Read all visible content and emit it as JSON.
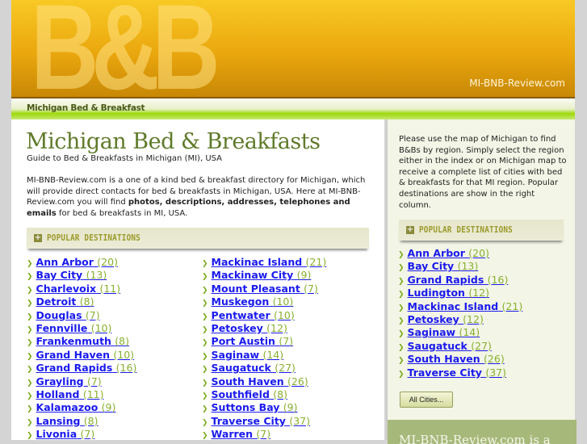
{
  "header": {
    "logo": "B&B",
    "site_name": "MI-BNB-Review.com"
  },
  "nav": {
    "title": "Michigan Bed & Breakfast"
  },
  "main": {
    "title": "Michigan Bed & Breakfasts",
    "subtitle": "Guide to Bed & Breakfasts in Michigan (MI), USA",
    "intro_1": "MI-BNB-Review.com is a one of a kind bed & breakfast directory for Michigan, which will provide direct contacts for bed & breakfasts in Michigan, USA. Here at MI-BNB-Review.com you will find ",
    "intro_bold": "photos, descriptions, addresses, telephones and emails",
    "intro_2": " for bed & breakfasts in MI, USA.",
    "dest_heading": "POPULAR DESTINATIONS",
    "col1": [
      {
        "name": "Ann Arbor",
        "count": "(20)"
      },
      {
        "name": "Bay City",
        "count": "(13)"
      },
      {
        "name": "Charlevoix",
        "count": "(11)"
      },
      {
        "name": "Detroit",
        "count": "(8)"
      },
      {
        "name": "Douglas",
        "count": "(7)"
      },
      {
        "name": "Fennville",
        "count": "(10)"
      },
      {
        "name": "Frankenmuth",
        "count": "(8)"
      },
      {
        "name": "Grand Haven",
        "count": "(10)"
      },
      {
        "name": "Grand Rapids",
        "count": "(16)"
      },
      {
        "name": "Grayling",
        "count": "(7)"
      },
      {
        "name": "Holland",
        "count": "(11)"
      },
      {
        "name": "Kalamazoo",
        "count": "(9)"
      },
      {
        "name": "Lansing",
        "count": "(8)"
      },
      {
        "name": "Livonia",
        "count": "(7)"
      }
    ],
    "col2": [
      {
        "name": "Mackinac Island",
        "count": "(21)"
      },
      {
        "name": "Mackinaw City",
        "count": "(9)"
      },
      {
        "name": "Mount Pleasant",
        "count": "(7)"
      },
      {
        "name": "Muskegon",
        "count": "(10)"
      },
      {
        "name": "Pentwater",
        "count": "(10)"
      },
      {
        "name": "Petoskey",
        "count": "(12)"
      },
      {
        "name": "Port Austin",
        "count": "(7)"
      },
      {
        "name": "Saginaw",
        "count": "(14)"
      },
      {
        "name": "Saugatuck",
        "count": "(27)"
      },
      {
        "name": "South Haven",
        "count": "(26)"
      },
      {
        "name": "Southfield",
        "count": "(8)"
      },
      {
        "name": "Suttons Bay",
        "count": "(9)"
      },
      {
        "name": "Traverse City",
        "count": "(37)"
      },
      {
        "name": "Warren",
        "count": "(7)"
      }
    ]
  },
  "sidebar": {
    "text": "Please use the map of Michigan to find B&Bs by region. Simply select the region either in the index or on Michigan map to receive a complete list of cities with bed & breakfasts for that MI region. Popular destinations are show in the right column.",
    "dest_heading": "POPULAR DESTINATIONS",
    "items": [
      {
        "name": "Ann Arbor",
        "count": "(20)"
      },
      {
        "name": "Bay City",
        "count": "(13)"
      },
      {
        "name": "Grand Rapids",
        "count": "(16)"
      },
      {
        "name": "Ludington",
        "count": "(12)"
      },
      {
        "name": "Mackinac Island",
        "count": "(21)"
      },
      {
        "name": "Petoskey",
        "count": "(12)"
      },
      {
        "name": "Saginaw",
        "count": "(14)"
      },
      {
        "name": "Saugatuck",
        "count": "(27)"
      },
      {
        "name": "South Haven",
        "count": "(26)"
      },
      {
        "name": "Traverse City",
        "count": "(37)"
      }
    ],
    "all_cities": "All Cities...",
    "bottom_text": "MI-BNB-Review.com is a"
  },
  "colors": {
    "link": "#1a1aee",
    "count": "#88b030",
    "title": "#5f7a2a",
    "header": "#eaa70e"
  }
}
